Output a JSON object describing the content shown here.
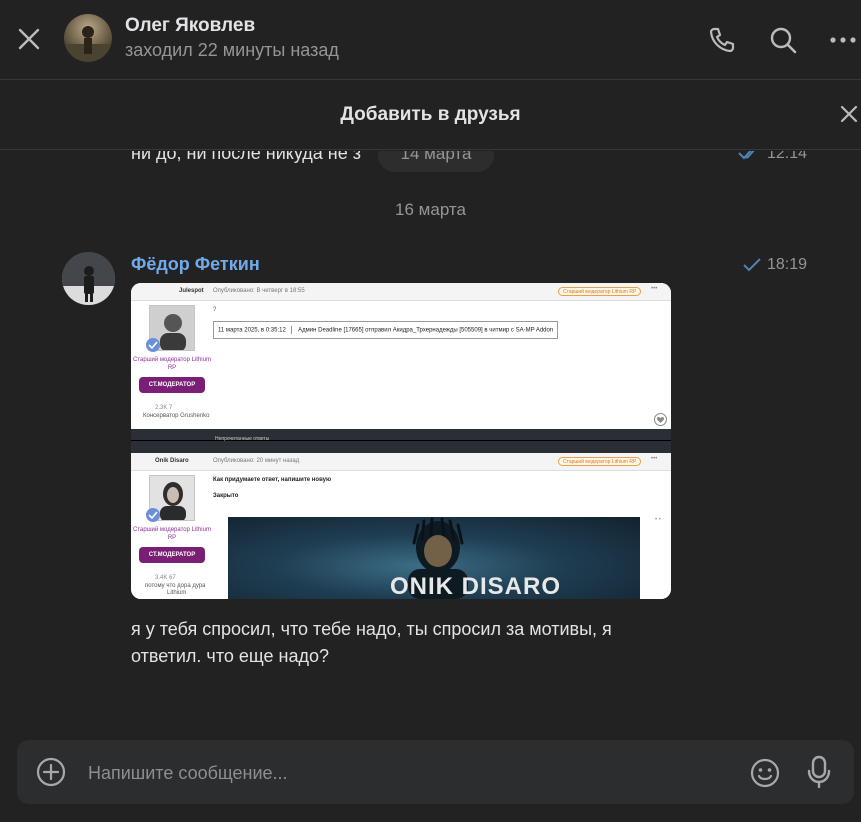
{
  "header": {
    "contact_name": "Олег Яковлев",
    "status": "заходил 22 минуты назад"
  },
  "add_friend": {
    "label": "Добавить в друзья"
  },
  "feed": {
    "previous_message": {
      "text": "ни до, ни после никуда не з",
      "time": "12:14"
    },
    "floating_date": "14 марта",
    "date_separator": "16 марта",
    "message": {
      "sender": "Фёдор Феткин",
      "time": "18:19",
      "text_lines": [
        "я у тебя спросил, что тебе надо, ты спросил за мотивы, я",
        "ответил. что еще надо?"
      ],
      "screenshot": {
        "post1": {
          "author": "Julespot",
          "published": "Опубликовано: В четверг в 18:55",
          "rank": "Старший модератор Lithium RP",
          "mod_title": "Старший модератор Lithium RP",
          "badge": "СТ.МОДЕРАТОР",
          "stats": "2.3K   7",
          "signature": "Консерватор Grushenko",
          "quote_date": "11 марта 2025, в 0:35:12",
          "quote_text": "Админ Deadline [17665] отправил Акидра_Трхернадежды [505509] в читмир с SA-MP Addon",
          "marker": "?"
        },
        "divider": "Непрочитанные ответы",
        "post2": {
          "author": "Onik Disaro",
          "published": "Опубликовано: 20 минут назад",
          "rank": "Старший модератор Lithium RP",
          "mod_title": "Старший модератор Lithium RP",
          "badge": "СТ.МОДЕРАТОР",
          "stats": "3.4K   67",
          "signature": "потому что дора дура",
          "signature2": "Lithium",
          "line1": "Как придумаете ответ, напишите новую",
          "line2": "Закрыто",
          "banner_text": "ONIK DISARO"
        }
      }
    }
  },
  "composer": {
    "placeholder": "Напишите сообщение..."
  },
  "colors": {
    "background": "#222222",
    "accent": "#71aaeb",
    "muted": "#939699",
    "composer_bg": "#2c2d2e"
  }
}
